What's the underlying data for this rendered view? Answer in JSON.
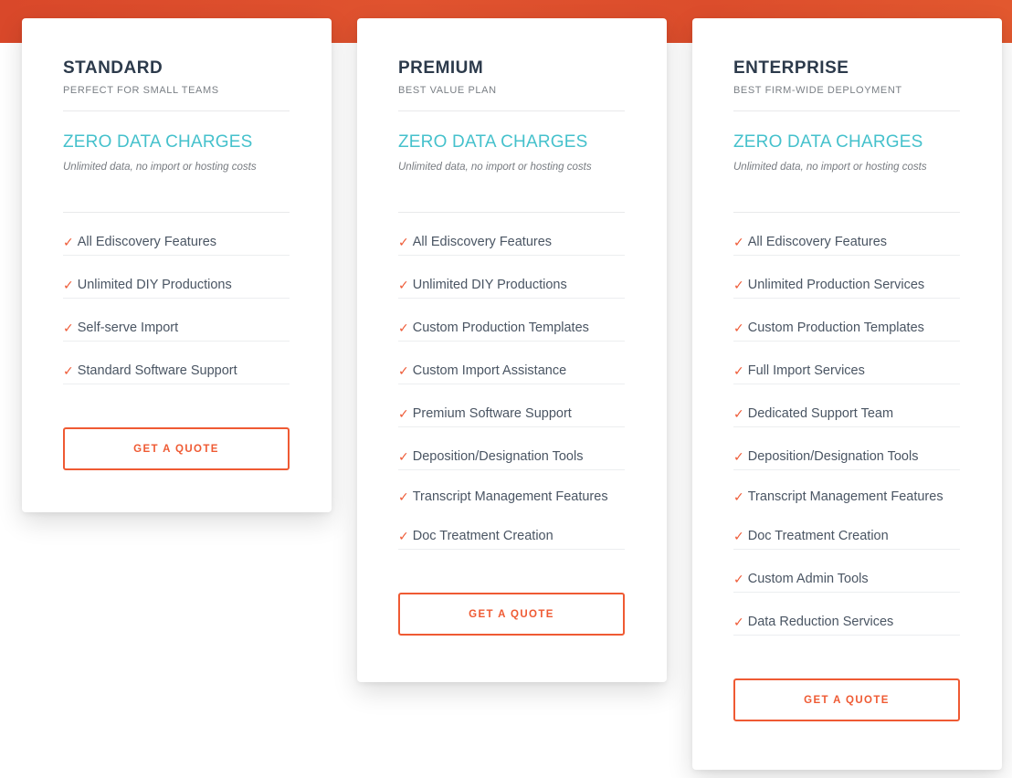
{
  "colors": {
    "brand_orange": "#ef5a33",
    "accent_teal": "#45c1cc",
    "heading_dark": "#2c3a4b",
    "check_color": "#ee5a36"
  },
  "plans": [
    {
      "name": "STANDARD",
      "tagline": "PERFECT FOR SMALL TEAMS",
      "headline": "ZERO DATA CHARGES",
      "subline": "Unlimited data, no import or hosting costs",
      "check_icon": "✓",
      "features": [
        "All Ediscovery Features",
        "Unlimited DIY Productions",
        "Self-serve Import",
        "Standard Software Support"
      ],
      "cta_label": "GET A QUOTE"
    },
    {
      "name": "PREMIUM",
      "tagline": "BEST VALUE PLAN",
      "headline": "ZERO DATA CHARGES",
      "subline": "Unlimited data, no import or hosting costs",
      "check_icon": "✓",
      "features": [
        "All Ediscovery Features",
        "Unlimited DIY Productions",
        "Custom Production Templates",
        "Custom Import Assistance",
        "Premium Software Support",
        "Deposition/Designation Tools",
        "Transcript Management Features",
        "Doc Treatment Creation"
      ],
      "cta_label": "GET A QUOTE"
    },
    {
      "name": "ENTERPRISE",
      "tagline": "BEST FIRM-WIDE DEPLOYMENT",
      "headline": "ZERO DATA CHARGES",
      "subline": "Unlimited data, no import or hosting costs",
      "check_icon": "✓",
      "features": [
        "All Ediscovery Features",
        "Unlimited Production Services",
        "Custom Production Templates",
        "Full Import Services",
        "Dedicated Support Team",
        "Deposition/Designation Tools",
        "Transcript Management Features",
        "Doc Treatment Creation",
        "Custom Admin Tools",
        "Data Reduction Services"
      ],
      "cta_label": "GET A QUOTE"
    }
  ]
}
